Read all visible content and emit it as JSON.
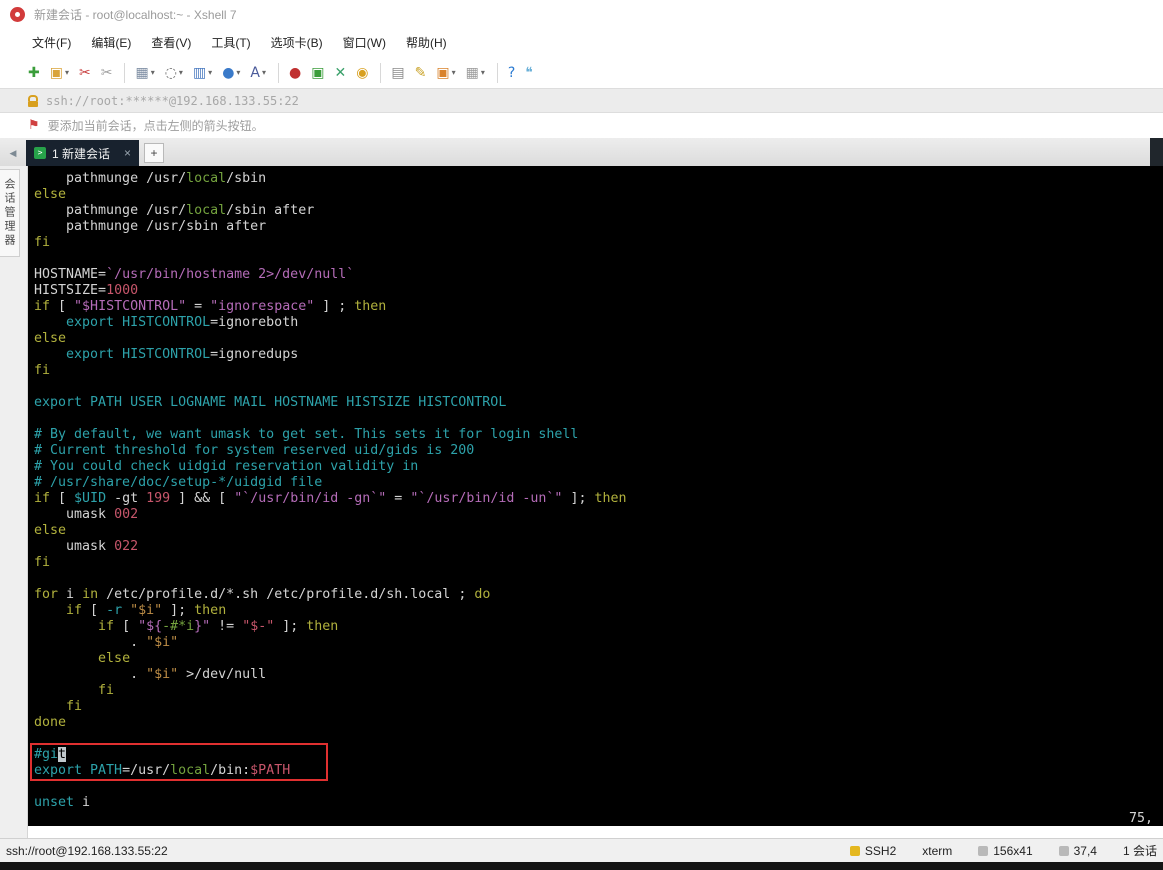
{
  "window": {
    "title": "新建会话 - root@localhost:~ - Xshell 7"
  },
  "menu": {
    "items": [
      {
        "name": "menu-file",
        "label": "文件(F)"
      },
      {
        "name": "menu-edit",
        "label": "编辑(E)"
      },
      {
        "name": "menu-view",
        "label": "查看(V)"
      },
      {
        "name": "menu-tools",
        "label": "工具(T)"
      },
      {
        "name": "menu-tabs",
        "label": "选项卡(B)"
      },
      {
        "name": "menu-window",
        "label": "窗口(W)"
      },
      {
        "name": "menu-help",
        "label": "帮助(H)"
      }
    ]
  },
  "toolbar": {
    "items": [
      {
        "name": "new-session-icon",
        "glyph": "✚",
        "color": "#3a9d3a"
      },
      {
        "name": "open-folder-icon",
        "glyph": "▣",
        "color": "#d9a43a",
        "caret": true
      },
      {
        "name": "disconnect-icon",
        "glyph": "✂",
        "color": "#c94040"
      },
      {
        "name": "reconnect-icon",
        "glyph": "✂",
        "color": "#a0a0a0"
      },
      {
        "sep": true
      },
      {
        "name": "properties-icon",
        "glyph": "▦",
        "color": "#7a8aa0",
        "caret": true
      },
      {
        "name": "find-icon",
        "glyph": "◌",
        "color": "#6a6a6a",
        "caret": true
      },
      {
        "name": "tile-layout-icon",
        "glyph": "▥",
        "color": "#4a7ac0",
        "caret": true
      },
      {
        "name": "web-browser-icon",
        "glyph": "●",
        "color": "#3a7ac9",
        "caret": true
      },
      {
        "name": "font-icon",
        "glyph": "A",
        "color": "#4a5a9a",
        "caret": true
      },
      {
        "sep": true
      },
      {
        "name": "record-log-icon",
        "glyph": "●",
        "color": "#c03030"
      },
      {
        "name": "file-transfer-icon",
        "glyph": "▣",
        "color": "#3a9d3a"
      },
      {
        "name": "fullscreen-icon",
        "glyph": "✕",
        "color": "#3aa06a"
      },
      {
        "name": "lock-screen-icon",
        "glyph": "◉",
        "color": "#d8a01f"
      },
      {
        "sep": true
      },
      {
        "name": "keyboard-icon",
        "glyph": "▤",
        "color": "#8a8a8a"
      },
      {
        "name": "highlight-pen-icon",
        "glyph": "✎",
        "color": "#c9a227"
      },
      {
        "name": "new-file-icon",
        "glyph": "▣",
        "color": "#d9822b",
        "caret": true
      },
      {
        "name": "panes-icon",
        "glyph": "▦",
        "color": "#9a9a9a",
        "caret": true
      },
      {
        "sep": true
      },
      {
        "name": "help-icon",
        "glyph": "?",
        "color": "#2a7ad2"
      },
      {
        "name": "feedback-icon",
        "glyph": "❝",
        "color": "#6ab0d8"
      }
    ]
  },
  "address_bar": {
    "value": "ssh://root:******@192.168.133.55:22"
  },
  "notice_bar": {
    "text": "要添加当前会话，点击左侧的箭头按钮。",
    "flag_glyph": "⚑"
  },
  "tabs": {
    "arrow_glyph": "◀",
    "active_label": "1 新建会话",
    "tab_icon_glyph": ">",
    "close_glyph": "×",
    "new_tab_label": "+"
  },
  "sidebar": {
    "vertical_label": "会话管理器"
  },
  "terminal": {
    "palette": {
      "w": "#d4d4d4",
      "y": "#b1b13d",
      "c": "#2da2aa",
      "m": "#b56cb8",
      "r": "#c7566b",
      "g": "#74a33e",
      "o": "#bd8d46",
      "cursor": "#c0c8cc"
    },
    "annotation_color": "#e03030",
    "ruler": "75,",
    "lines": [
      [
        [
          "    pathmunge /usr/",
          "w"
        ],
        [
          "local",
          "g"
        ],
        [
          "/sbin",
          "w"
        ]
      ],
      [
        [
          "else",
          "y"
        ]
      ],
      [
        [
          "    pathmunge /usr/",
          "w"
        ],
        [
          "local",
          "g"
        ],
        [
          "/sbin after",
          "w"
        ]
      ],
      [
        [
          "    pathmunge /usr/sbin after",
          "w"
        ]
      ],
      [
        [
          "fi",
          "y"
        ]
      ],
      [],
      [
        [
          "HOSTNAME=",
          "w"
        ],
        [
          "`/usr/bin/hostname 2>/dev/null`",
          "m"
        ]
      ],
      [
        [
          "HISTSIZE=",
          "w"
        ],
        [
          "1000",
          "r"
        ]
      ],
      [
        [
          "if",
          "y"
        ],
        [
          " [ ",
          "w"
        ],
        [
          "\"$HISTCONTROL\"",
          "m"
        ],
        [
          " = ",
          "w"
        ],
        [
          "\"ignorespace\"",
          "m"
        ],
        [
          " ] ; ",
          "w"
        ],
        [
          "then",
          "y"
        ]
      ],
      [
        [
          "    ",
          "w"
        ],
        [
          "export HISTCONTROL",
          "c"
        ],
        [
          "=ignoreboth",
          "w"
        ]
      ],
      [
        [
          "else",
          "y"
        ]
      ],
      [
        [
          "    ",
          "w"
        ],
        [
          "export HISTCONTROL",
          "c"
        ],
        [
          "=ignoredups",
          "w"
        ]
      ],
      [
        [
          "fi",
          "y"
        ]
      ],
      [],
      [
        [
          "export PATH USER LOGNAME MAIL HOSTNAME HISTSIZE HISTCONTROL",
          "c"
        ]
      ],
      [],
      [
        [
          "# By default, we want umask to get set. This sets it for login shell",
          "c"
        ]
      ],
      [
        [
          "# Current threshold for system reserved uid/gids is 200",
          "c"
        ]
      ],
      [
        [
          "# You could check uidgid reservation validity in",
          "c"
        ]
      ],
      [
        [
          "# /usr/share/doc/setup-*/uidgid file",
          "c"
        ]
      ],
      [
        [
          "if",
          "y"
        ],
        [
          " [ ",
          "w"
        ],
        [
          "$UID",
          "c"
        ],
        [
          " -gt ",
          "w"
        ],
        [
          "199",
          "r"
        ],
        [
          " ] && [ ",
          "w"
        ],
        [
          "\"`/usr/bin/id -gn`\"",
          "m"
        ],
        [
          " = ",
          "w"
        ],
        [
          "\"`/usr/bin/id -un`\"",
          "m"
        ],
        [
          " ]; ",
          "w"
        ],
        [
          "then",
          "y"
        ]
      ],
      [
        [
          "    umask ",
          "w"
        ],
        [
          "002",
          "r"
        ]
      ],
      [
        [
          "else",
          "y"
        ]
      ],
      [
        [
          "    umask ",
          "w"
        ],
        [
          "022",
          "r"
        ]
      ],
      [
        [
          "fi",
          "y"
        ]
      ],
      [],
      [
        [
          "for",
          "y"
        ],
        [
          " i ",
          "w"
        ],
        [
          "in",
          "y"
        ],
        [
          " /etc/profile.d/*.sh /etc/profile.d/sh.local ; ",
          "w"
        ],
        [
          "do",
          "y"
        ]
      ],
      [
        [
          "    ",
          "w"
        ],
        [
          "if",
          "y"
        ],
        [
          " [ ",
          "w"
        ],
        [
          "-r",
          "c"
        ],
        [
          " ",
          "w"
        ],
        [
          "\"$i\"",
          "o"
        ],
        [
          " ]; ",
          "w"
        ],
        [
          "then",
          "y"
        ]
      ],
      [
        [
          "        ",
          "w"
        ],
        [
          "if",
          "y"
        ],
        [
          " [ ",
          "w"
        ],
        [
          "\"${",
          "m"
        ],
        [
          "-#*i",
          "g"
        ],
        [
          "}\"",
          "m"
        ],
        [
          " != ",
          "w"
        ],
        [
          "\"$-\"",
          "r"
        ],
        [
          " ]; ",
          "w"
        ],
        [
          "then",
          "y"
        ]
      ],
      [
        [
          "            . ",
          "w"
        ],
        [
          "\"$i\"",
          "o"
        ]
      ],
      [
        [
          "        ",
          "w"
        ],
        [
          "else",
          "y"
        ]
      ],
      [
        [
          "            . ",
          "w"
        ],
        [
          "\"$i\"",
          "o"
        ],
        [
          " >/dev/null",
          "w"
        ]
      ],
      [
        [
          "        ",
          "w"
        ],
        [
          "fi",
          "y"
        ]
      ],
      [
        [
          "    ",
          "w"
        ],
        [
          "fi",
          "y"
        ]
      ],
      [
        [
          "done",
          "y"
        ]
      ],
      [],
      [
        [
          "#gi",
          "c"
        ],
        [
          "t",
          "k"
        ]
      ],
      [
        [
          "export PATH",
          "c"
        ],
        [
          "=/usr/",
          "w"
        ],
        [
          "local",
          "g"
        ],
        [
          "/bin:",
          "w"
        ],
        [
          "$PATH",
          "r"
        ]
      ],
      [],
      [
        [
          "unset",
          "c"
        ],
        [
          " i",
          "w"
        ]
      ]
    ]
  },
  "status_bar": {
    "left": "ssh://root@192.168.133.55:22",
    "items": [
      {
        "name": "status-protocol",
        "label": "SSH2",
        "icon": "yellow"
      },
      {
        "name": "status-terminal-type",
        "label": "xterm",
        "icon": "none"
      },
      {
        "name": "status-terminal-size",
        "label": "156x41",
        "icon": "gray"
      },
      {
        "name": "status-cursor-position",
        "label": "37,4",
        "icon": "gray"
      },
      {
        "name": "status-session-count",
        "label": "1 会话",
        "icon": "none"
      }
    ]
  }
}
